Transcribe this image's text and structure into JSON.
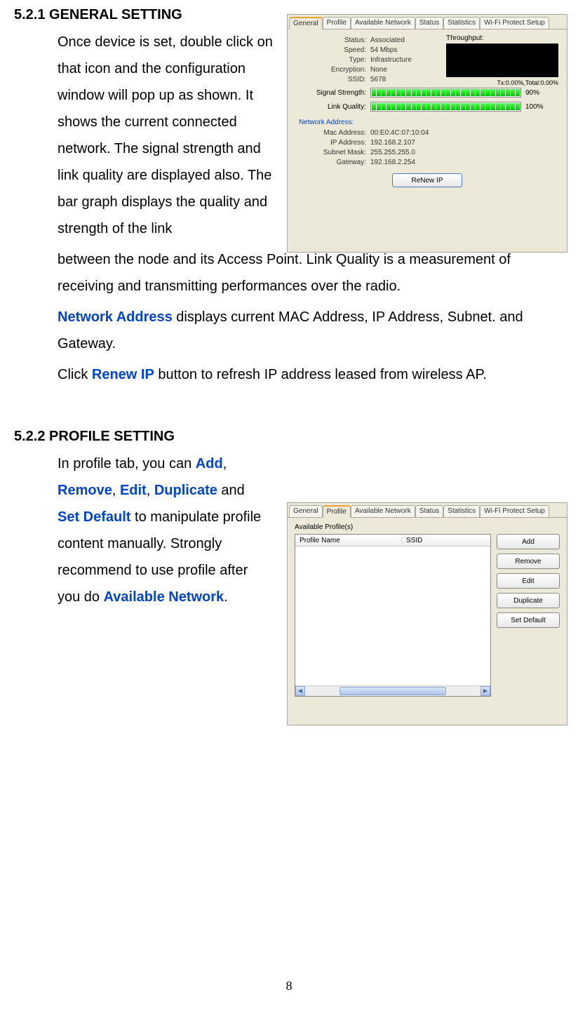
{
  "section1": {
    "heading": "5.2.1 GENERAL SETTING",
    "p1": "Once device is set, double click on that icon and the configuration window will pop up as shown. It shows the current connected network. The signal strength and link quality are displayed also. The bar graph displays the quality and strength of the link",
    "p1b": "between the node and its Access Point. Link Quality is a measurement of receiving and transmitting performances over the radio.",
    "p2_pre": "",
    "network_address": "Network Address",
    "p2_post": " displays current MAC Address, IP Address, Subnet. and Gateway.",
    "p3_pre": "Click ",
    "renew_ip": "Renew IP",
    "p3_post": " button to refresh IP address leased from wireless AP."
  },
  "section2": {
    "heading": "5.2.2 PROFILE SETTING",
    "intro": "In profile tab, you can",
    "add": "Add",
    "remove": "Remove",
    "edit": "Edit",
    "duplicate": "Duplicate",
    "and": " and ",
    "set_default": "Set Default",
    "to": " to manipulate profile content manually. Strongly recommend to use profile after you do ",
    "available_network": "Available Network",
    "period": "."
  },
  "general_tab": {
    "tabs": [
      "General",
      "Profile",
      "Available Network",
      "Status",
      "Statistics",
      "Wi-Fi Protect Setup"
    ],
    "status_l": "Status:",
    "status_v": "Associated",
    "speed_l": "Speed:",
    "speed_v": "54 Mbps",
    "type_l": "Type:",
    "type_v": "Infrastructure",
    "enc_l": "Encryption:",
    "enc_v": "None",
    "ssid_l": "SSID:",
    "ssid_v": "5678",
    "throughput_l": "Throughput:",
    "throughput_stats": "Tx:0.00%,Total:0.00%",
    "signal_l": "Signal Strength:",
    "signal_pct": "90%",
    "link_l": "Link Quality:",
    "link_pct": "100%",
    "net_addr_l": "Network Address:",
    "mac_l": "Mac Address:",
    "mac_v": "00:E0:4C:07:10:04",
    "ip_l": "IP Address:",
    "ip_v": "192.168.2.107",
    "subnet_l": "Subnet Mask:",
    "subnet_v": "255.255.255.0",
    "gw_l": "Gateway:",
    "gw_v": "192.168.2.254",
    "renew_btn": "ReNew IP"
  },
  "profile_tab": {
    "tabs": [
      "General",
      "Profile",
      "Available Network",
      "Status",
      "Statistics",
      "Wi-Fi Protect Setup"
    ],
    "avail_label": "Available Profile(s)",
    "col1": "Profile Name",
    "col2": "SSID",
    "btn_add": "Add",
    "btn_remove": "Remove",
    "btn_edit": "Edit",
    "btn_dup": "Duplicate",
    "btn_setdef": "Set Default"
  },
  "page_num": "8"
}
